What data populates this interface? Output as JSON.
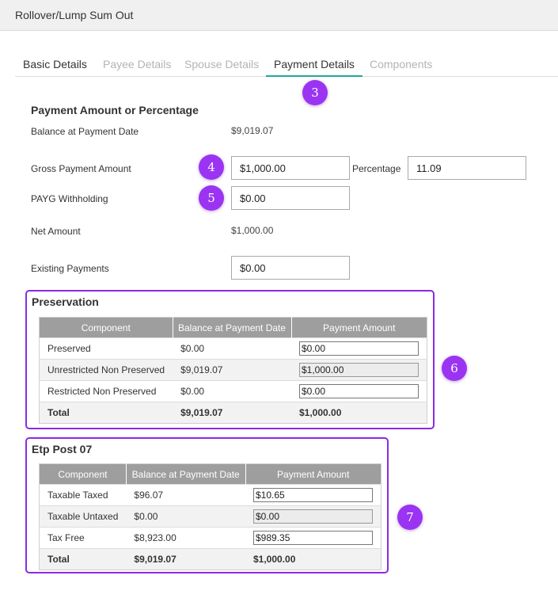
{
  "window": {
    "title": "Rollover/Lump Sum Out"
  },
  "tabs": [
    {
      "label": "Basic Details"
    },
    {
      "label": "Payee Details"
    },
    {
      "label": "Spouse Details"
    },
    {
      "label": "Payment Details"
    },
    {
      "label": "Components"
    }
  ],
  "badges": {
    "b3": "3",
    "b4": "4",
    "b5": "5",
    "b6": "6",
    "b7": "7"
  },
  "payment": {
    "section_title": "Payment Amount or Percentage",
    "balance_label": "Balance at Payment Date",
    "balance_value": "$9,019.07",
    "gross_label": "Gross Payment Amount",
    "gross_value": "$1,000.00",
    "percentage_label": "Percentage",
    "percentage_value": "11.09",
    "payg_label": "PAYG Withholding",
    "payg_value": "$0.00",
    "net_label": "Net Amount",
    "net_value": "$1,000.00",
    "existing_label": "Existing Payments",
    "existing_value": "$0.00"
  },
  "preservation": {
    "title": "Preservation",
    "headers": [
      "Component",
      "Balance at Payment Date",
      "Payment Amount"
    ],
    "rows": [
      {
        "component": "Preserved",
        "balance": "$0.00",
        "payment": "$0.00"
      },
      {
        "component": "Unrestricted Non Preserved",
        "balance": "$9,019.07",
        "payment": "$1,000.00"
      },
      {
        "component": "Restricted Non Preserved",
        "balance": "$0.00",
        "payment": "$0.00"
      }
    ],
    "total": {
      "label": "Total",
      "balance": "$9,019.07",
      "payment": "$1,000.00"
    }
  },
  "etp": {
    "title": "Etp Post 07",
    "headers": [
      "Component",
      "Balance at Payment Date",
      "Payment Amount"
    ],
    "rows": [
      {
        "component": "Taxable Taxed",
        "balance": "$96.07",
        "payment": "$10.65"
      },
      {
        "component": "Taxable Untaxed",
        "balance": "$0.00",
        "payment": "$0.00"
      },
      {
        "component": "Tax Free",
        "balance": "$8,923.00",
        "payment": "$989.35"
      }
    ],
    "total": {
      "label": "Total",
      "balance": "$9,019.07",
      "payment": "$1,000.00"
    }
  },
  "colors": {
    "accent_tab": "#26a69a",
    "highlight": "#8a2be2",
    "badge": "#9b34f2",
    "table_header": "#9e9e9e"
  }
}
